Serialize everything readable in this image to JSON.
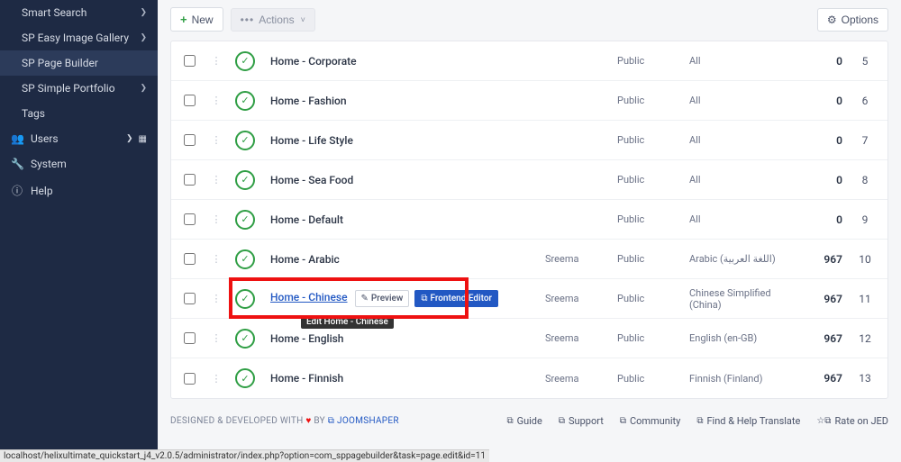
{
  "sidebar": {
    "items": [
      {
        "label": "Smart Search",
        "expand": true
      },
      {
        "label": "SP Easy Image Gallery",
        "expand": true
      },
      {
        "label": "SP Page Builder",
        "expand": false,
        "active": true
      },
      {
        "label": "SP Simple Portfolio",
        "expand": true
      },
      {
        "label": "Tags",
        "expand": false
      }
    ],
    "cats": [
      {
        "icon": "users",
        "label": "Users",
        "chev": true,
        "grid": true
      },
      {
        "icon": "wrench",
        "label": "System"
      },
      {
        "icon": "info",
        "label": "Help"
      }
    ]
  },
  "toolbar": {
    "new_label": "New",
    "actions_label": "Actions",
    "options_label": "Options"
  },
  "rows": [
    {
      "title": "Home - Corporate",
      "author": "",
      "access": "Public",
      "lang": "All",
      "hits": "0",
      "id": "5"
    },
    {
      "title": "Home - Fashion",
      "author": "",
      "access": "Public",
      "lang": "All",
      "hits": "0",
      "id": "6"
    },
    {
      "title": "Home - Life Style",
      "author": "",
      "access": "Public",
      "lang": "All",
      "hits": "0",
      "id": "7"
    },
    {
      "title": "Home - Sea Food",
      "author": "",
      "access": "Public",
      "lang": "All",
      "hits": "0",
      "id": "8"
    },
    {
      "title": "Home - Default",
      "author": "",
      "access": "Public",
      "lang": "All",
      "hits": "0",
      "id": "9"
    },
    {
      "title": "Home - Arabic",
      "author": "Sreema",
      "access": "Public",
      "lang": "Arabic (اللغة العربية)",
      "hits": "967",
      "id": "10"
    },
    {
      "title": "Home - Chinese",
      "author": "Sreema",
      "access": "Public",
      "lang": "Chinese Simplified (China)",
      "hits": "967",
      "id": "11",
      "hl": true
    },
    {
      "title": "Home - English",
      "author": "Sreema",
      "access": "Public",
      "lang": "English (en-GB)",
      "hits": "967",
      "id": "12"
    },
    {
      "title": "Home - Finnish",
      "author": "Sreema",
      "access": "Public",
      "lang": "Finnish (Finland)",
      "hits": "967",
      "id": "13"
    }
  ],
  "hl_buttons": {
    "preview": "Preview",
    "frontend": "Frontend Editor",
    "tooltip": "Edit Home -   Chinese"
  },
  "footer": {
    "designed": "DESIGNED & DEVELOPED WITH",
    "by": "BY",
    "brand": "JOOMSHAPER",
    "links": [
      {
        "label": "Guide"
      },
      {
        "label": "Support"
      },
      {
        "label": "Community"
      },
      {
        "label": "Find & Help Translate"
      },
      {
        "label": "Rate on JED",
        "star": true
      }
    ]
  },
  "statusbar": "localhost/helixultimate_quickstart_j4_v2.0.5/administrator/index.php?option=com_sppagebuilder&task=page.edit&id=11"
}
